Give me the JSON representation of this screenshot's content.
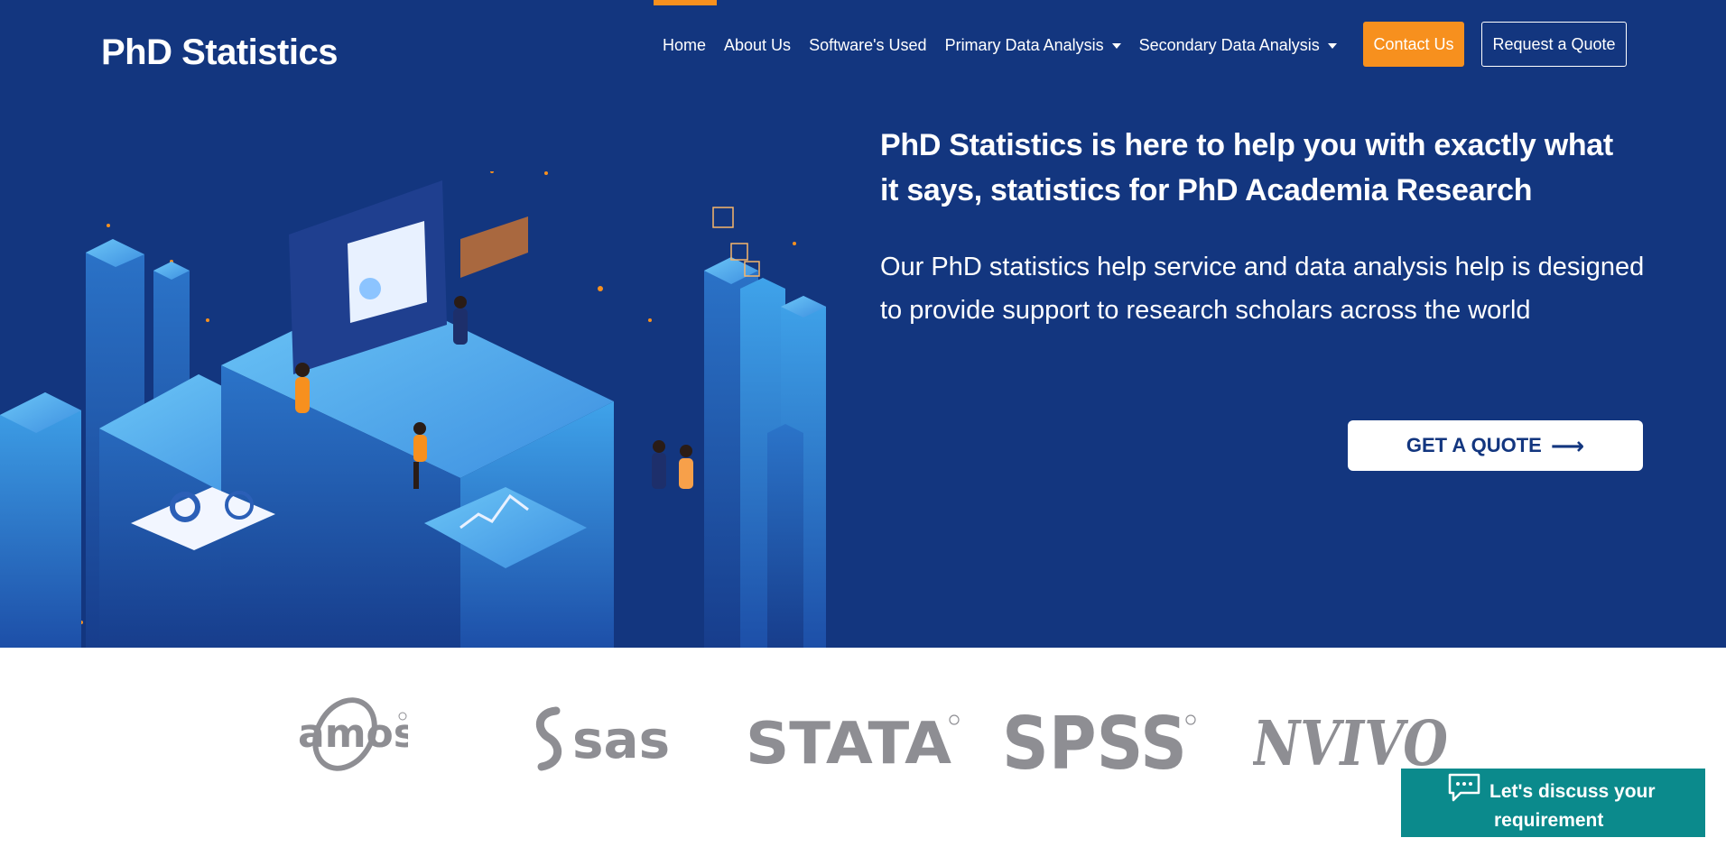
{
  "brand": "PhD Statistics",
  "nav": {
    "items": [
      {
        "label": "Home",
        "dropdown": false
      },
      {
        "label": "About Us",
        "dropdown": false
      },
      {
        "label": "Software's Used",
        "dropdown": false
      },
      {
        "label": "Primary Data Analysis",
        "dropdown": true
      },
      {
        "label": "Secondary Data Analysis",
        "dropdown": true
      }
    ],
    "active": "Home",
    "contact_label": "Contact Us",
    "quote_label": "Request a Quote"
  },
  "hero": {
    "headline": "PhD Statistics is here to help you with exactly what it says, statistics for PhD Academia Research",
    "subtext": "Our PhD statistics help service and data analysis help is designed to provide support to research scholars across the world",
    "cta_label": "GET A QUOTE",
    "cta_icon": "arrow-right-icon"
  },
  "logos": [
    "amos",
    "sas",
    "STATA",
    "SPSS",
    "NVIVO"
  ],
  "chat": {
    "line1": "Let's discuss your",
    "line2": "requirement",
    "icon": "chat-bubble-icon"
  },
  "colors": {
    "hero_bg": "#13367f",
    "accent": "#f7901e",
    "chat_bg": "#0b8a8c",
    "logo_gray": "#8e8e93"
  }
}
